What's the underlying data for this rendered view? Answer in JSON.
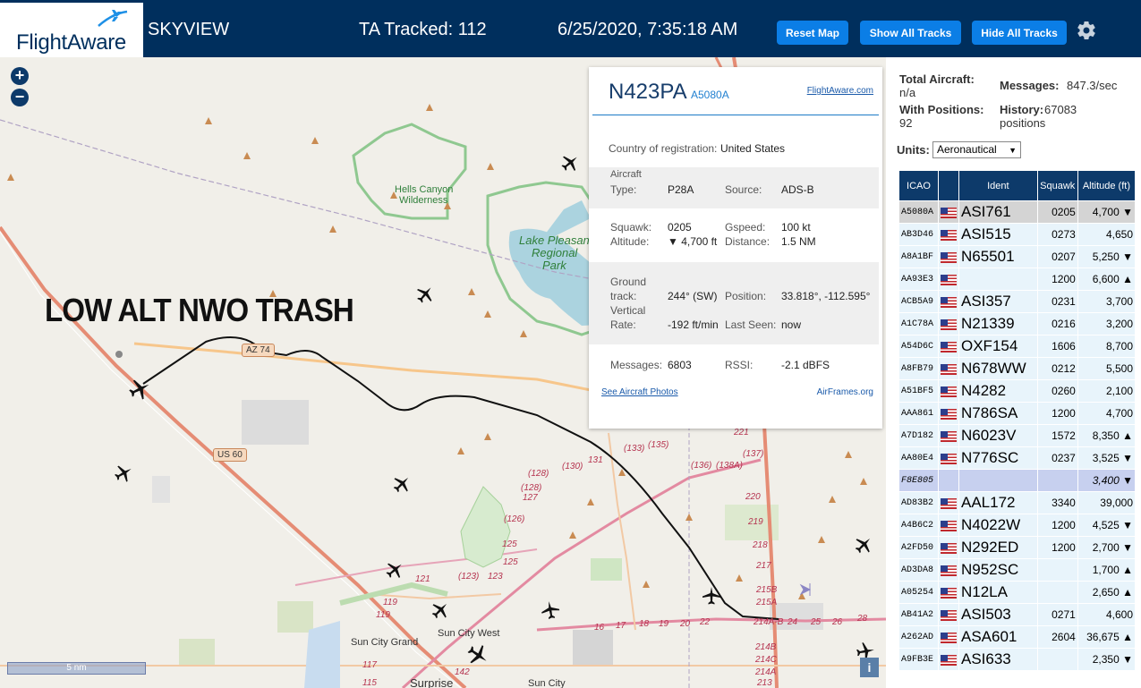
{
  "header": {
    "logo_text": "FlightAware",
    "app_name": "SKYVIEW",
    "ta_tracked": "TA Tracked: 112",
    "datetime": "6/25/2020, 7:35:18 AM",
    "buttons": {
      "reset": "Reset Map",
      "show_all": "Show All Tracks",
      "hide_all": "Hide All Tracks"
    }
  },
  "map": {
    "zoom_in": "+",
    "zoom_out": "−",
    "overlay_text": "LOW ALT NWO TRASH",
    "scale_label": "5 nm",
    "info_label": "i",
    "place_labels": {
      "hells_canyon": "Hells Canyon",
      "wilderness": "Wilderness",
      "lake_pleasant": "Lake Pleasant",
      "regional": "Regional",
      "park": "Park",
      "sun_city_grand": "Sun City Grand",
      "sun_city_west": "Sun City West",
      "surprise": "Surprise",
      "sun_city": "Sun City"
    },
    "road_labels": {
      "az74": "AZ 74",
      "us60": "US 60"
    },
    "mile_markers": [
      "(135)",
      "(133)",
      "131",
      "(130)",
      "(128)",
      "(128)",
      "127",
      "(126)",
      "125",
      "125",
      "123",
      "(123)",
      "121",
      "119",
      "119",
      "117",
      "115",
      "142",
      "(136)",
      "(138A)",
      "(137)",
      "221",
      "220",
      "219",
      "218",
      "217",
      "215B",
      "215A",
      "214A-B",
      "214B",
      "214C",
      "214A",
      "213",
      "24",
      "25",
      "26",
      "28",
      "17",
      "18",
      "19",
      "20",
      "22",
      "16"
    ]
  },
  "popup": {
    "ident": "N423PA",
    "hex": "A5080A",
    "fa_link": "FlightAware.com",
    "country_label": "Country of registration:",
    "country": "United States",
    "aircraft_type_label": "Aircraft",
    "aircraft_type_label2": "Type:",
    "aircraft_type": "P28A",
    "source_label": "Source:",
    "source": "ADS-B",
    "squawk_label": "Squawk:",
    "squawk": "0205",
    "gspeed_label": "Gspeed:",
    "gspeed": "100 kt",
    "altitude_label": "Altitude:",
    "altitude": "▼ 4,700 ft",
    "distance_label": "Distance:",
    "distance": "1.5 NM",
    "ground_track_label1": "Ground",
    "ground_track_label2": "track:",
    "ground_track": "244° (SW)",
    "position_label": "Position:",
    "position": "33.818°, -112.595°",
    "vrate_label1": "Vertical",
    "vrate_label2": "Rate:",
    "vrate": "-192 ft/min",
    "last_seen_label": "Last Seen:",
    "last_seen": "now",
    "messages_label": "Messages:",
    "messages": "6803",
    "rssi_label": "RSSI:",
    "rssi": "-2.1 dBFS",
    "photos_link": "See Aircraft Photos",
    "airframes_link": "AirFrames.org"
  },
  "sidebar": {
    "total_aircraft_label": "Total Aircraft:",
    "total_aircraft": "n/a",
    "messages_label": "Messages:",
    "messages": "847.3/sec",
    "with_positions_label": "With Positions:",
    "with_positions": "92",
    "history_label": "History:",
    "history": "67083",
    "history_unit": "positions",
    "units_label": "Units:",
    "units_value": "Aeronautical",
    "columns": [
      "ICAO",
      "",
      "Ident",
      "Squawk",
      "Altitude (ft)"
    ],
    "rows": [
      {
        "icao": "A5080A",
        "ident": "ASI761",
        "squawk": "0205",
        "alt": "4,700 ▼",
        "flag": true,
        "sel": true
      },
      {
        "icao": "AB3D46",
        "ident": "ASI515",
        "squawk": "0273",
        "alt": "4,650",
        "flag": true
      },
      {
        "icao": "A8A1BF",
        "ident": "N65501",
        "squawk": "0207",
        "alt": "5,250 ▼",
        "flag": true
      },
      {
        "icao": "AA93E3",
        "ident": "",
        "squawk": "1200",
        "alt": "6,600 ▲",
        "flag": true
      },
      {
        "icao": "ACB5A9",
        "ident": "ASI357",
        "squawk": "0231",
        "alt": "3,700",
        "flag": true
      },
      {
        "icao": "A1C78A",
        "ident": "N21339",
        "squawk": "0216",
        "alt": "3,200",
        "flag": true
      },
      {
        "icao": "A54D6C",
        "ident": "OXF154",
        "squawk": "1606",
        "alt": "8,700",
        "flag": true
      },
      {
        "icao": "A8FB79",
        "ident": "N678WW",
        "squawk": "0212",
        "alt": "5,500",
        "flag": true
      },
      {
        "icao": "A51BF5",
        "ident": "N4282",
        "squawk": "0260",
        "alt": "2,100",
        "flag": true
      },
      {
        "icao": "AAA861",
        "ident": "N786SA",
        "squawk": "1200",
        "alt": "4,700",
        "flag": true
      },
      {
        "icao": "A7D182",
        "ident": "N6023V",
        "squawk": "1572",
        "alt": "8,350 ▲",
        "flag": true
      },
      {
        "icao": "AA80E4",
        "ident": "N776SC",
        "squawk": "0237",
        "alt": "3,525 ▼",
        "flag": true
      },
      {
        "icao": "F8E805",
        "ident": "",
        "squawk": "",
        "alt": "3,400 ▼",
        "flag": false,
        "mlat": true
      },
      {
        "icao": "AD83B2",
        "ident": "AAL172",
        "squawk": "3340",
        "alt": "39,000",
        "flag": true
      },
      {
        "icao": "A4B6C2",
        "ident": "N4022W",
        "squawk": "1200",
        "alt": "4,525 ▼",
        "flag": true
      },
      {
        "icao": "A2FD50",
        "ident": "N292ED",
        "squawk": "1200",
        "alt": "2,700 ▼",
        "flag": true
      },
      {
        "icao": "AD3DA8",
        "ident": "N952SC",
        "squawk": "",
        "alt": "1,700 ▲",
        "flag": true
      },
      {
        "icao": "A05254",
        "ident": "N12LA",
        "squawk": "",
        "alt": "2,650 ▲",
        "flag": true
      },
      {
        "icao": "AB41A2",
        "ident": "ASI503",
        "squawk": "0271",
        "alt": "4,600",
        "flag": true
      },
      {
        "icao": "A262AD",
        "ident": "ASA601",
        "squawk": "2604",
        "alt": "36,675 ▲",
        "flag": true
      },
      {
        "icao": "A9FB3E",
        "ident": "ASI633",
        "squawk": "",
        "alt": "2,350 ▼",
        "flag": true
      }
    ]
  },
  "colors": {
    "header_bg": "#002f5d",
    "button_bg": "#0b7ee6",
    "table_header": "#0d3a6a",
    "row_bg": "#e8f4fb",
    "mlat_row": "#c7d0ef"
  }
}
